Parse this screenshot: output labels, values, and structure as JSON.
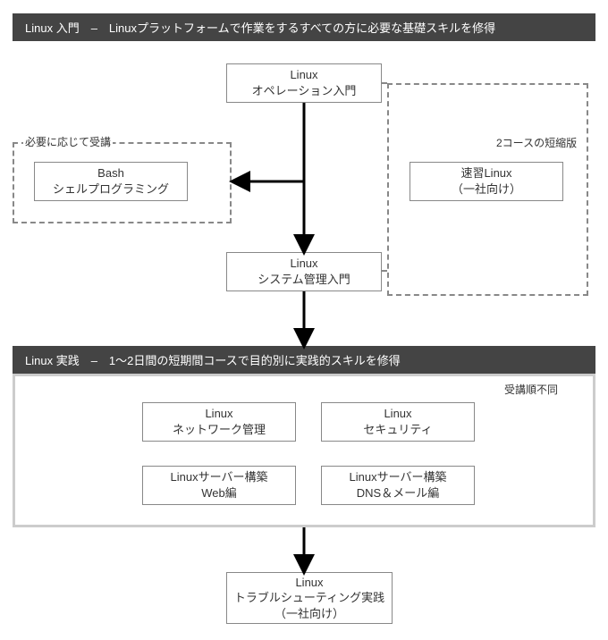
{
  "headers": {
    "intro": "Linux 入門　–　Linuxプラットフォームで作業をするすべての方に必要な基礎スキルを修得",
    "practice": "Linux 実践　–　1～2日間の短期間コースで目的別に実践的スキルを修得"
  },
  "labels": {
    "optional": "必要に応じて受講",
    "condensed": "2コースの短縮版",
    "anyorder": "受講順不同"
  },
  "courses": {
    "op_intro_l1": "Linux",
    "op_intro_l2": "オペレーション入門",
    "bash_l1": "Bash",
    "bash_l2": "シェルプログラミング",
    "rapid_l1": "速習Linux",
    "rapid_l2": "（一社向け）",
    "sysadmin_l1": "Linux",
    "sysadmin_l2": "システム管理入門",
    "network_l1": "Linux",
    "network_l2": "ネットワーク管理",
    "security_l1": "Linux",
    "security_l2": "セキュリティ",
    "srv_web_l1": "Linuxサーバー構築",
    "srv_web_l2": "Web編",
    "srv_dns_l1": "Linuxサーバー構築",
    "srv_dns_l2": "DNS＆メール編",
    "trouble_l1": "Linux",
    "trouble_l2": "トラブルシューティング実践",
    "trouble_l3": "（一社向け）"
  }
}
